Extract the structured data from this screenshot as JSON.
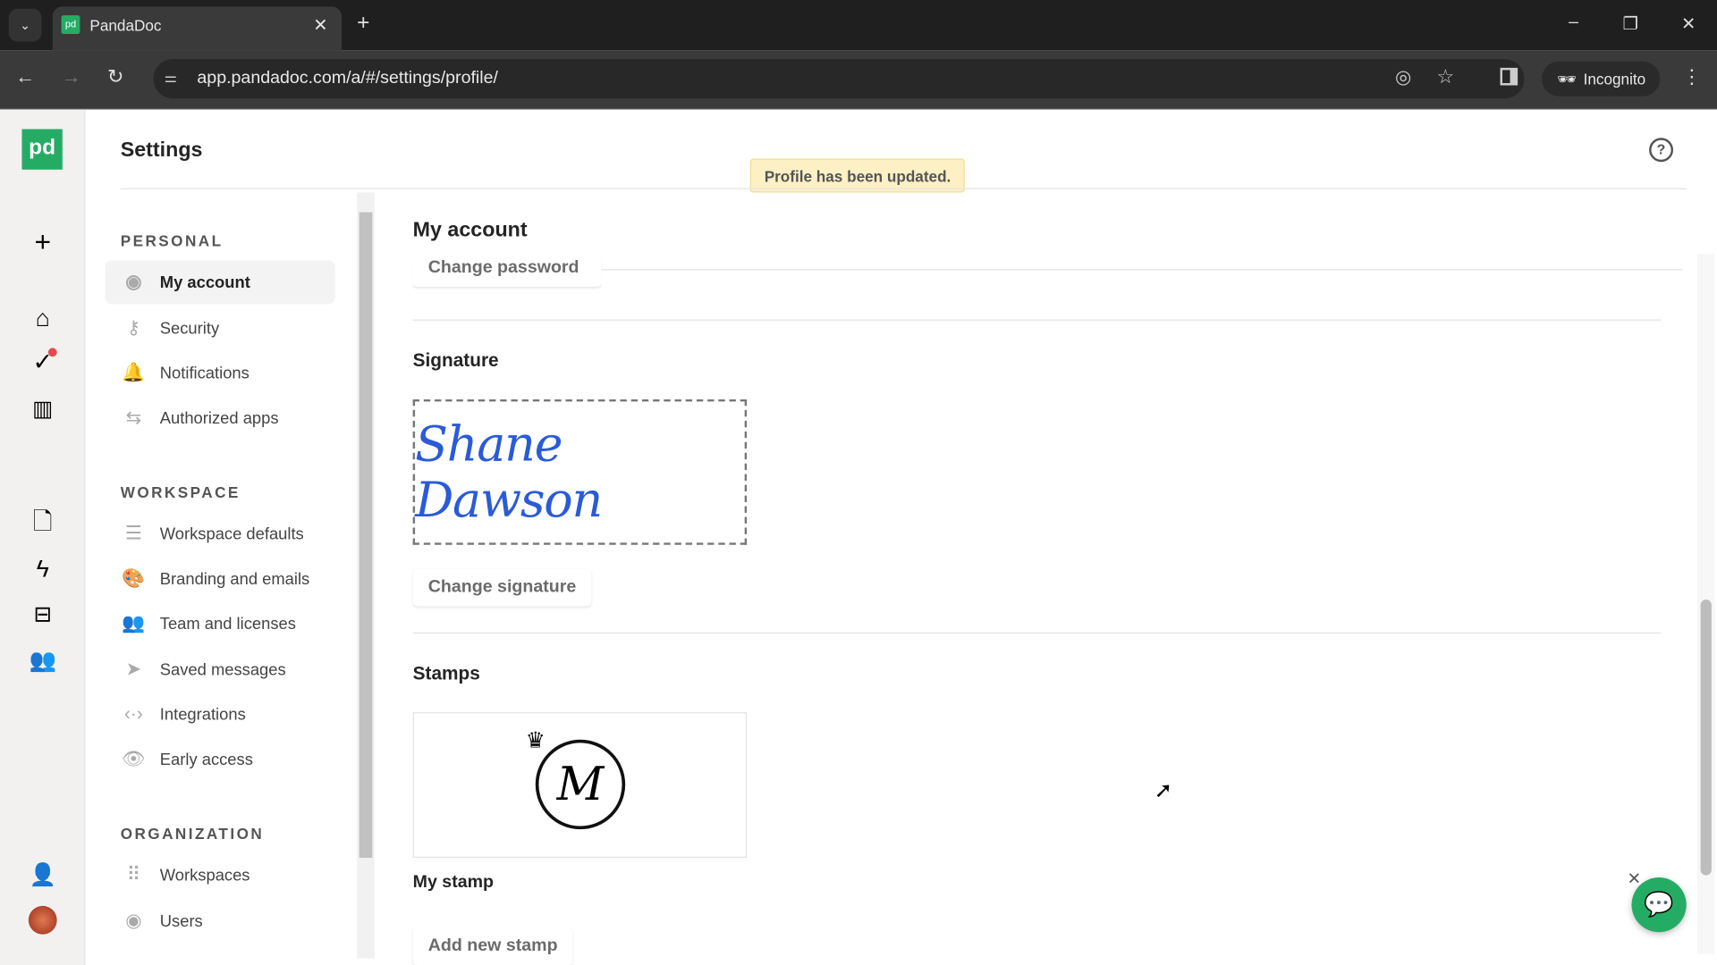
{
  "browser": {
    "tab_title": "PandaDoc",
    "url": "app.pandadoc.com/a/#/settings/profile/",
    "incognito_label": "Incognito"
  },
  "header": {
    "title": "Settings",
    "toast": "Profile has been updated.",
    "logo": "pd"
  },
  "nav": {
    "personal_label": "PERSONAL",
    "personal": [
      {
        "label": "My account",
        "icon": "user-circle-icon"
      },
      {
        "label": "Security",
        "icon": "key-icon"
      },
      {
        "label": "Notifications",
        "icon": "bell-icon"
      },
      {
        "label": "Authorized apps",
        "icon": "swap-icon"
      }
    ],
    "workspace_label": "WORKSPACE",
    "workspace": [
      {
        "label": "Workspace defaults",
        "icon": "sliders-icon"
      },
      {
        "label": "Branding and emails",
        "icon": "palette-icon"
      },
      {
        "label": "Team and licenses",
        "icon": "team-icon"
      },
      {
        "label": "Saved messages",
        "icon": "send-icon"
      },
      {
        "label": "Integrations",
        "icon": "code-icon"
      },
      {
        "label": "Early access",
        "icon": "eye-icon"
      }
    ],
    "organization_label": "ORGANIZATION",
    "organization": [
      {
        "label": "Workspaces",
        "icon": "grid-icon"
      },
      {
        "label": "Users",
        "icon": "user-circle-icon"
      }
    ]
  },
  "main": {
    "title": "My account",
    "change_password": "Change password",
    "signature_title": "Signature",
    "signature_text": "Shane Dawson",
    "change_signature": "Change signature",
    "stamps_title": "Stamps",
    "stamp_letter": "M",
    "stamp_name": "My stamp",
    "add_stamp": "Add new stamp"
  },
  "colors": {
    "brand": "#25ac64",
    "signature": "#2a5bd7",
    "toast_bg": "#fdf0c4"
  }
}
